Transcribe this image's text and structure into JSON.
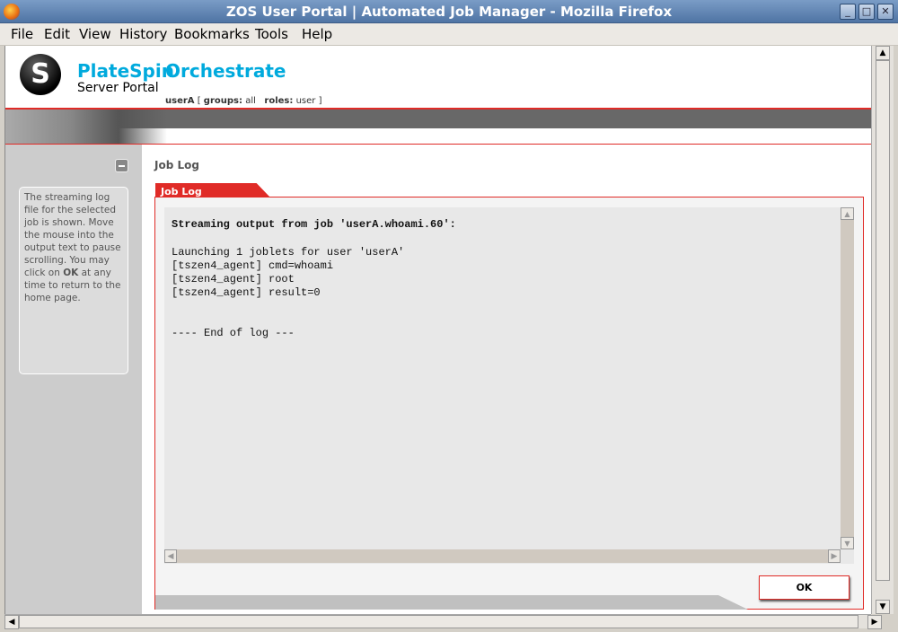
{
  "window": {
    "title": "ZOS User Portal | Automated Job Manager - Mozilla Firefox"
  },
  "menu": [
    "File",
    "Edit",
    "View",
    "History",
    "Bookmarks",
    "Tools",
    "Help"
  ],
  "header": {
    "brand1": "PlateSpin",
    "brand2": "Orchestrate",
    "subtitle": "Server Portal",
    "user": "userA",
    "groups_label": "groups:",
    "groups": "all",
    "roles_label": "roles:",
    "roles": "user"
  },
  "sidebar": {
    "help_pre": "The streaming log file for the selected job is shown. Move the mouse into the output text to pause scrolling. You may click on ",
    "help_bold": "OK",
    "help_post": " at any time to return to the home page."
  },
  "main": {
    "heading": "Job Log",
    "tab": "Job Log",
    "log_title": "Streaming output from job 'userA.whoami.60':",
    "log_lines": [
      "Launching 1 joblets for user 'userA'",
      "[tszen4_agent] cmd=whoami",
      "[tszen4_agent] root",
      "[tszen4_agent] result=0"
    ],
    "log_end": "---- End of log ---",
    "ok": "OK"
  },
  "colors": {
    "accent": "#e02b27",
    "brand": "#00aadd"
  }
}
